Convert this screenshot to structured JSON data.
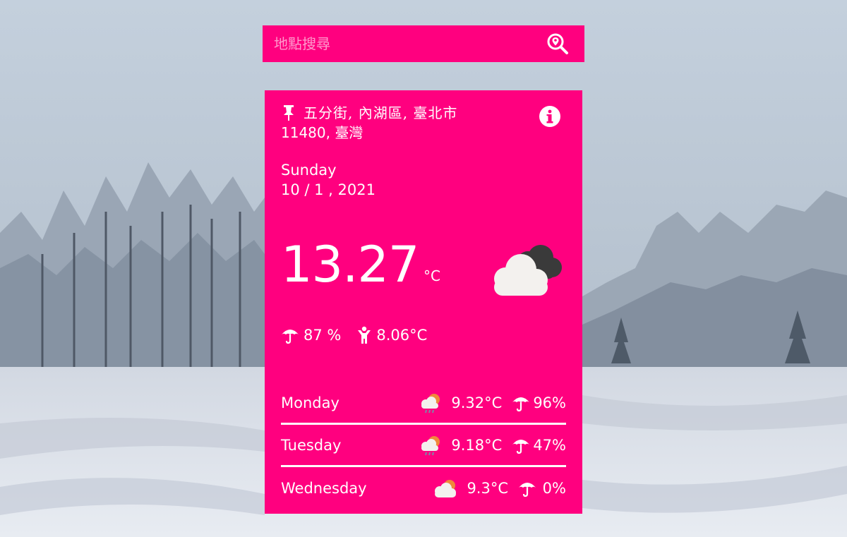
{
  "search": {
    "placeholder": "地點搜尋"
  },
  "location": {
    "line1": "五分街, 內湖區, 臺北市",
    "line2": "11480, 臺灣"
  },
  "date": {
    "weekday": "Sunday",
    "date": "10 / 1 , 2021"
  },
  "current": {
    "temperature": "13.27",
    "unit": "°C",
    "icon": "cloudy-icon",
    "humidity": "87 %",
    "feels_like": "8.06°C"
  },
  "forecast": [
    {
      "day": "Monday",
      "icon": "sun-rain-icon",
      "temp": "9.32°C",
      "rain": "96%"
    },
    {
      "day": "Tuesday",
      "icon": "sun-rain-icon",
      "temp": "9.18°C",
      "rain": "47%"
    },
    {
      "day": "Wednesday",
      "icon": "partly-cloudy-icon",
      "temp": "9.3°C",
      "rain": "0%"
    }
  ],
  "colors": {
    "accent": "#ff007f",
    "text": "#ffffff"
  }
}
